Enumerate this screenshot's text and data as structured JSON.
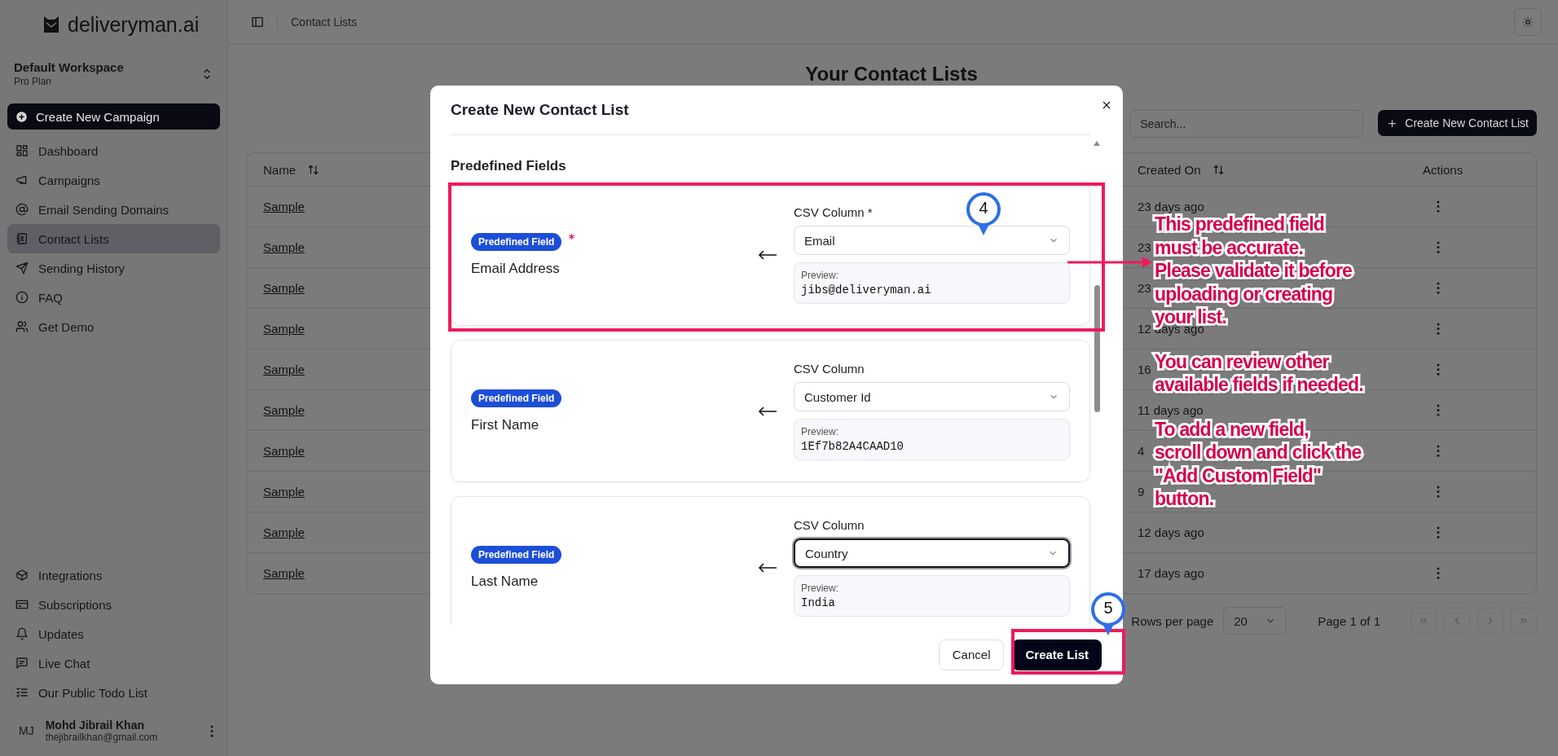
{
  "brand": {
    "name": "deliveryman.ai"
  },
  "workspace": {
    "name": "Default Workspace",
    "plan": "Pro Plan"
  },
  "sidebar": {
    "primary_action": "Create New Campaign",
    "items": [
      {
        "label": "Dashboard",
        "selected": false
      },
      {
        "label": "Campaigns",
        "selected": false
      },
      {
        "label": "Email Sending Domains",
        "selected": false
      },
      {
        "label": "Contact Lists",
        "selected": true
      },
      {
        "label": "Sending History",
        "selected": false
      },
      {
        "label": "FAQ",
        "selected": false
      },
      {
        "label": "Get Demo",
        "selected": false
      }
    ],
    "bottom_items": [
      {
        "label": "Integrations"
      },
      {
        "label": "Subscriptions"
      },
      {
        "label": "Updates"
      },
      {
        "label": "Live Chat"
      },
      {
        "label": "Our Public Todo List"
      }
    ]
  },
  "user": {
    "initials": "MJ",
    "name": "Mohd Jibrail Khan",
    "email": "thejibrailkhan@gmail.com"
  },
  "header": {
    "breadcrumb": "Contact Lists"
  },
  "page": {
    "title": "Your Contact Lists",
    "search": {
      "placeholder": "Search..."
    },
    "create_button": "Create New Contact List"
  },
  "table": {
    "columns": [
      {
        "label": "Name",
        "sortable": true
      },
      {
        "label": "Created On",
        "sortable": true
      },
      {
        "label": "Actions",
        "sortable": false
      }
    ],
    "rows": [
      {
        "name": "Sample",
        "created_on": "23 days ago"
      },
      {
        "name": "Sample",
        "created_on": "23"
      },
      {
        "name": "Sample",
        "created_on": "23"
      },
      {
        "name": "Sample",
        "created_on": "12 days ago"
      },
      {
        "name": "Sample",
        "created_on": "16"
      },
      {
        "name": "Sample",
        "created_on": "11 days ago"
      },
      {
        "name": "Sample",
        "created_on": "4"
      },
      {
        "name": "Sample",
        "created_on": "9"
      },
      {
        "name": "Sample",
        "created_on": "12 days ago"
      },
      {
        "name": "Sample",
        "created_on": "17 days ago"
      }
    ]
  },
  "pagination": {
    "rows_per_page_label": "Rows per page",
    "rows_per_page": "20",
    "page_info": "Page 1 of 1"
  },
  "modal": {
    "title": "Create New Contact List",
    "section": "Predefined Fields",
    "fields": [
      {
        "badge": "Predefined Field",
        "required": true,
        "label": "Email Address",
        "csv_label": "CSV Column *",
        "csv_value": "Email",
        "focused": false,
        "preview_label": "Preview:",
        "preview": "jibs@deliveryman.ai"
      },
      {
        "badge": "Predefined Field",
        "required": false,
        "label": "First Name",
        "csv_label": "CSV Column",
        "csv_value": "Customer Id",
        "focused": false,
        "preview_label": "Preview:",
        "preview": "1Ef7b82A4CAAD10"
      },
      {
        "badge": "Predefined Field",
        "required": false,
        "label": "Last Name",
        "csv_label": "CSV Column",
        "csv_value": "Country",
        "focused": true,
        "preview_label": "Preview:",
        "preview": "India"
      }
    ],
    "buttons": {
      "cancel": "Cancel",
      "submit": "Create List"
    }
  },
  "annotations": {
    "markers": [
      "4",
      "5"
    ],
    "notes": [
      {
        "lines": [
          "This predefined field",
          "must be accurate.",
          "Please validate it before",
          "uploading or creating",
          "your list."
        ]
      },
      {
        "lines": [
          "You can review other",
          "available fields if needed."
        ]
      },
      {
        "lines": [
          "To add a new field,",
          "scroll down and click the",
          "\"Add Custom Field\"",
          "button."
        ]
      }
    ]
  }
}
